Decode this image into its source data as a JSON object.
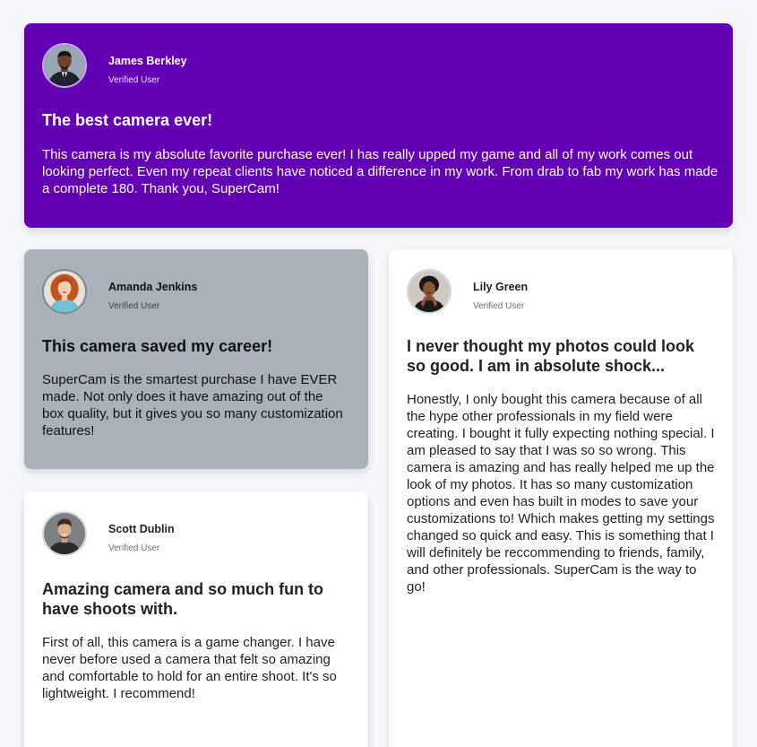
{
  "colors": {
    "featured_background": "#6400b4",
    "muted_background": "#a9b1b9",
    "card_background": "#ffffff",
    "page_background": "#f4f6f9"
  },
  "testimonials": [
    {
      "name": "James Berkley",
      "status": "Verified User",
      "avatar_icon": "user-avatar-photo",
      "title": "The best camera ever!",
      "body": "This camera is my absolute favorite purchase ever! I has really upped my game and all of my work comes out looking perfect. Even my repeat clients have noticed a difference in my work. From drab to fab my work has made a complete 180. Thank you, SuperCam!"
    },
    {
      "name": "Amanda Jenkins",
      "status": "Verified User",
      "avatar_icon": "user-avatar-photo",
      "title": "This camera saved my career!",
      "body": "SuperCam is the smartest purchase I have EVER made. Not only does it have amazing out of the box quality, but it gives you so many customization features!"
    },
    {
      "name": "Lily Green",
      "status": "Verified User",
      "avatar_icon": "user-avatar-photo",
      "title": "I never thought my photos could look so good. I am in absolute shock...",
      "body": "Honestly, I only bought this camera because of all the hype other professionals in my field were creating. I bought it fully expecting nothing special. I am pleased to say that I was so so wrong. This camera is amazing and has really helped me up the look of my photos. It has so many customization options and even has built in modes to save your customizations to! Which makes getting my settings changed so quick and easy. This is something that I will definitely be reccommending to friends, family, and other professionals. SuperCam is the way to go!"
    },
    {
      "name": "Scott Dublin",
      "status": "Verified User",
      "avatar_icon": "user-avatar-photo",
      "title": "Amazing camera and so much fun to have shoots with.",
      "body": "First of all, this camera is a game changer. I have never before used a camera that felt so amazing and comfortable to hold for an entire shoot. It's so lightweight. I recommend!"
    }
  ]
}
